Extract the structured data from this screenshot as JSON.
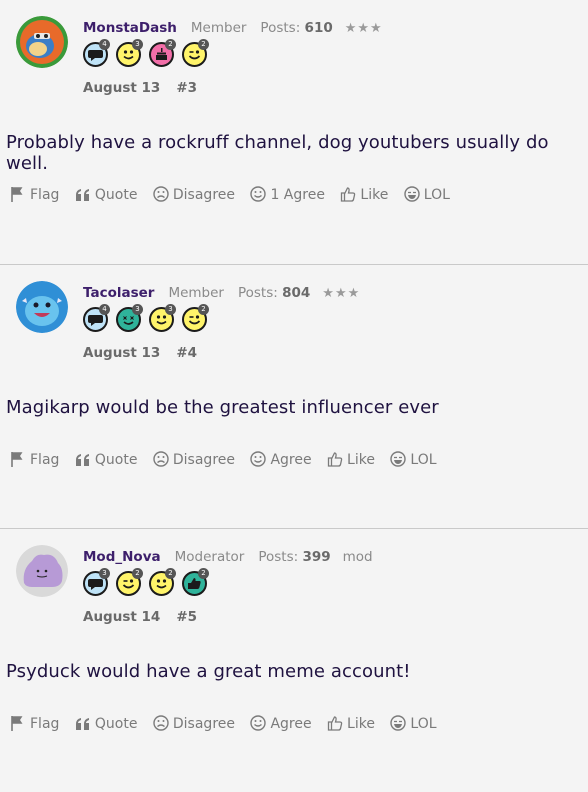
{
  "posts": [
    {
      "username": "MonstaDash",
      "role": "Member",
      "posts_label": "Posts:",
      "posts_count": "610",
      "rank": "★★★",
      "date": "August 13",
      "post_number": "#3",
      "text": "Probably have a rockruff channel, dog youtubers usually do well.",
      "badges": [
        {
          "icon": "speech-bubble-badge-icon",
          "count": "4",
          "color": "#bfe3f7"
        },
        {
          "icon": "smile-face-badge-icon",
          "count": "3",
          "color": "#fff46a"
        },
        {
          "icon": "cake-badge-icon",
          "count": "2",
          "color": "#f26ea8"
        },
        {
          "icon": "wink-face-badge-icon",
          "count": "2",
          "color": "#fff46a"
        }
      ],
      "actions": {
        "flag": "Flag",
        "quote": "Quote",
        "disagree": "Disagree",
        "agree": "1 Agree",
        "like": "Like",
        "lol": "LOL"
      }
    },
    {
      "username": "Tacolaser",
      "role": "Member",
      "posts_label": "Posts:",
      "posts_count": "804",
      "rank": "★★★",
      "date": "August 13",
      "post_number": "#4",
      "text": "Magikarp would be the greatest influencer ever",
      "badges": [
        {
          "icon": "speech-bubble-badge-icon",
          "count": "4",
          "color": "#bfe3f7"
        },
        {
          "icon": "star-face-badge-icon",
          "count": "3",
          "color": "#2fb39a"
        },
        {
          "icon": "smile-face-badge-icon",
          "count": "3",
          "color": "#fff46a"
        },
        {
          "icon": "wink-face-badge-icon",
          "count": "2",
          "color": "#fff46a"
        }
      ],
      "actions": {
        "flag": "Flag",
        "quote": "Quote",
        "disagree": "Disagree",
        "agree": "Agree",
        "like": "Like",
        "lol": "LOL"
      }
    },
    {
      "username": "Mod_Nova",
      "role": "Moderator",
      "posts_label": "Posts:",
      "posts_count": "399",
      "rank": "mod",
      "date": "August 14",
      "post_number": "#5",
      "text": "Psyduck would have a great meme account!",
      "badges": [
        {
          "icon": "speech-bubble-badge-icon",
          "count": "3",
          "color": "#bfe3f7"
        },
        {
          "icon": "wink-face-badge-icon",
          "count": "2",
          "color": "#fff46a"
        },
        {
          "icon": "smile-face-badge-icon",
          "count": "2",
          "color": "#fff46a"
        },
        {
          "icon": "thumbs-badge-icon",
          "count": "2",
          "color": "#2fb39a"
        }
      ],
      "actions": {
        "flag": "Flag",
        "quote": "Quote",
        "disagree": "Disagree",
        "agree": "Agree",
        "like": "Like",
        "lol": "LOL"
      }
    }
  ],
  "colors": {
    "username": "#3d1f6b",
    "body_text": "#1f1240",
    "muted": "#7a7a7a",
    "background": "#f4f4f4"
  }
}
